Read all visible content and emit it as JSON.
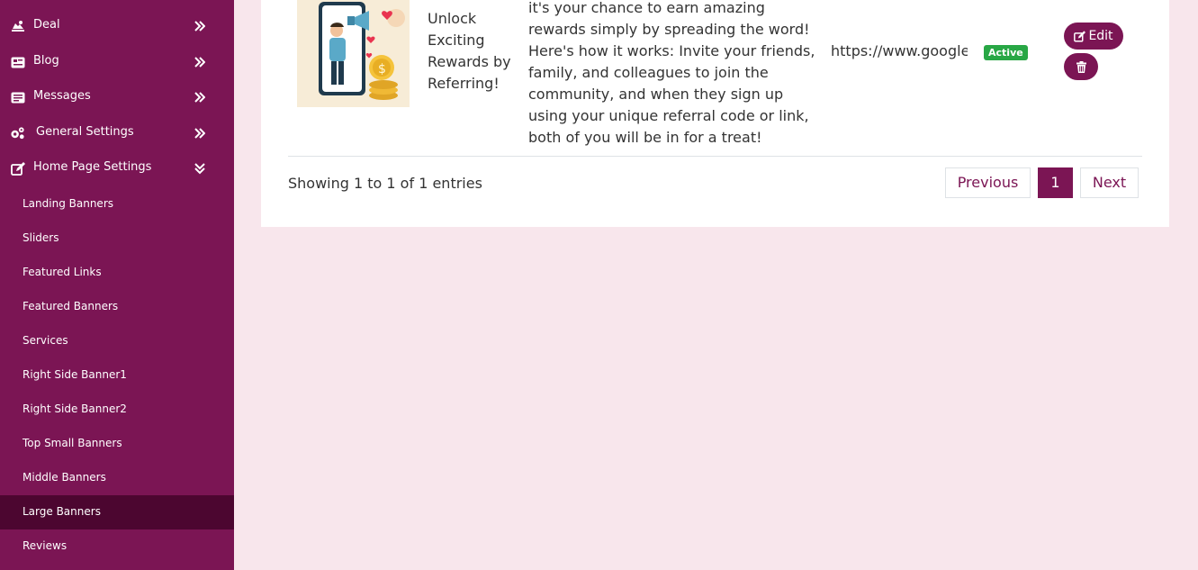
{
  "sidebar": {
    "menu": [
      {
        "label": "Deal",
        "icon": "deal-icon"
      },
      {
        "label": "Blog",
        "icon": "blog-icon"
      },
      {
        "label": "Messages",
        "icon": "messages-icon"
      },
      {
        "label": "General Settings",
        "icon": "gears-icon"
      },
      {
        "label": "Home Page Settings",
        "icon": "edit-icon"
      }
    ],
    "submenu": [
      {
        "label": "Landing Banners"
      },
      {
        "label": "Sliders"
      },
      {
        "label": "Featured Links"
      },
      {
        "label": "Featured Banners"
      },
      {
        "label": "Services"
      },
      {
        "label": "Right Side Banner1"
      },
      {
        "label": "Right Side Banner2"
      },
      {
        "label": "Top Small Banners"
      },
      {
        "label": "Middle Banners"
      },
      {
        "label": "Large Banners",
        "active": true
      },
      {
        "label": "Reviews"
      }
    ]
  },
  "table": {
    "row": {
      "title": "Unlock Exciting Rewards by Referring!",
      "description": "it's your chance to earn amazing rewards simply by spreading the word! Here's how it works: Invite your friends, family, and colleagues to join the community, and when they sign up using your unique referral code or link, both of you will be in for a treat!",
      "link": "https://www.google.com",
      "status": "Active",
      "edit_label": "Edit"
    },
    "info": "Showing 1 to 1 of 1 entries",
    "pagination": {
      "previous": "Previous",
      "current": "1",
      "next": "Next"
    }
  },
  "colors": {
    "primary": "#7b1554",
    "active_sub": "#4c0630",
    "page_bg": "#f8e6ec",
    "badge": "#28a745"
  }
}
